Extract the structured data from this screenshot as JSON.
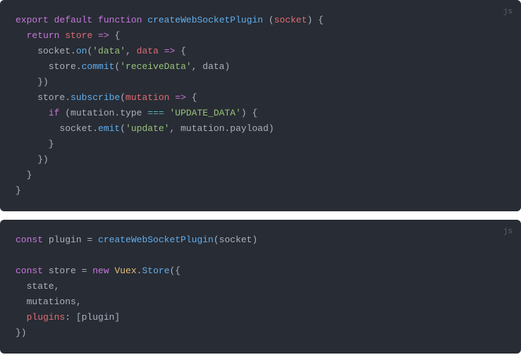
{
  "blocks": [
    {
      "lang": "js",
      "tokens": [
        [
          [
            "kw",
            "export"
          ],
          [
            "pln",
            " "
          ],
          [
            "kw",
            "default"
          ],
          [
            "pln",
            " "
          ],
          [
            "kw",
            "function"
          ],
          [
            "pln",
            " "
          ],
          [
            "fn",
            "createWebSocketPlugin"
          ],
          [
            "pln",
            " ("
          ],
          [
            "prop",
            "socket"
          ],
          [
            "pln",
            ") {"
          ]
        ],
        [
          [
            "pln",
            "  "
          ],
          [
            "kw",
            "return"
          ],
          [
            "pln",
            " "
          ],
          [
            "prop",
            "store"
          ],
          [
            "pln",
            " "
          ],
          [
            "kw",
            "=>"
          ],
          [
            "pln",
            " {"
          ]
        ],
        [
          [
            "pln",
            "    socket."
          ],
          [
            "fn",
            "on"
          ],
          [
            "pln",
            "("
          ],
          [
            "str",
            "'data'"
          ],
          [
            "pln",
            ", "
          ],
          [
            "prop",
            "data"
          ],
          [
            "pln",
            " "
          ],
          [
            "kw",
            "=>"
          ],
          [
            "pln",
            " {"
          ]
        ],
        [
          [
            "pln",
            "      store."
          ],
          [
            "fn",
            "commit"
          ],
          [
            "pln",
            "("
          ],
          [
            "str",
            "'receiveData'"
          ],
          [
            "pln",
            ", data)"
          ]
        ],
        [
          [
            "pln",
            "    })"
          ]
        ],
        [
          [
            "pln",
            "    store."
          ],
          [
            "fn",
            "subscribe"
          ],
          [
            "pln",
            "("
          ],
          [
            "prop",
            "mutation"
          ],
          [
            "pln",
            " "
          ],
          [
            "kw",
            "=>"
          ],
          [
            "pln",
            " {"
          ]
        ],
        [
          [
            "pln",
            "      "
          ],
          [
            "kw",
            "if"
          ],
          [
            "pln",
            " (mutation.type "
          ],
          [
            "op",
            "==="
          ],
          [
            "pln",
            " "
          ],
          [
            "str",
            "'UPDATE_DATA'"
          ],
          [
            "pln",
            ") {"
          ]
        ],
        [
          [
            "pln",
            "        socket."
          ],
          [
            "fn",
            "emit"
          ],
          [
            "pln",
            "("
          ],
          [
            "str",
            "'update'"
          ],
          [
            "pln",
            ", mutation.payload)"
          ]
        ],
        [
          [
            "pln",
            "      }"
          ]
        ],
        [
          [
            "pln",
            "    })"
          ]
        ],
        [
          [
            "pln",
            "  }"
          ]
        ],
        [
          [
            "pln",
            "}"
          ]
        ]
      ]
    },
    {
      "lang": "js",
      "tokens": [
        [
          [
            "kw",
            "const"
          ],
          [
            "pln",
            " plugin = "
          ],
          [
            "fn",
            "createWebSocketPlugin"
          ],
          [
            "pln",
            "(socket)"
          ]
        ],
        [],
        [
          [
            "kw",
            "const"
          ],
          [
            "pln",
            " store = "
          ],
          [
            "kw",
            "new"
          ],
          [
            "pln",
            " "
          ],
          [
            "cls",
            "Vuex"
          ],
          [
            "pln",
            "."
          ],
          [
            "fn",
            "Store"
          ],
          [
            "pln",
            "({"
          ]
        ],
        [
          [
            "pln",
            "  state,"
          ]
        ],
        [
          [
            "pln",
            "  mutations,"
          ]
        ],
        [
          [
            "pln",
            "  "
          ],
          [
            "prop",
            "plugins"
          ],
          [
            "pln",
            ": [plugin]"
          ]
        ],
        [
          [
            "pln",
            "})"
          ]
        ]
      ]
    }
  ]
}
